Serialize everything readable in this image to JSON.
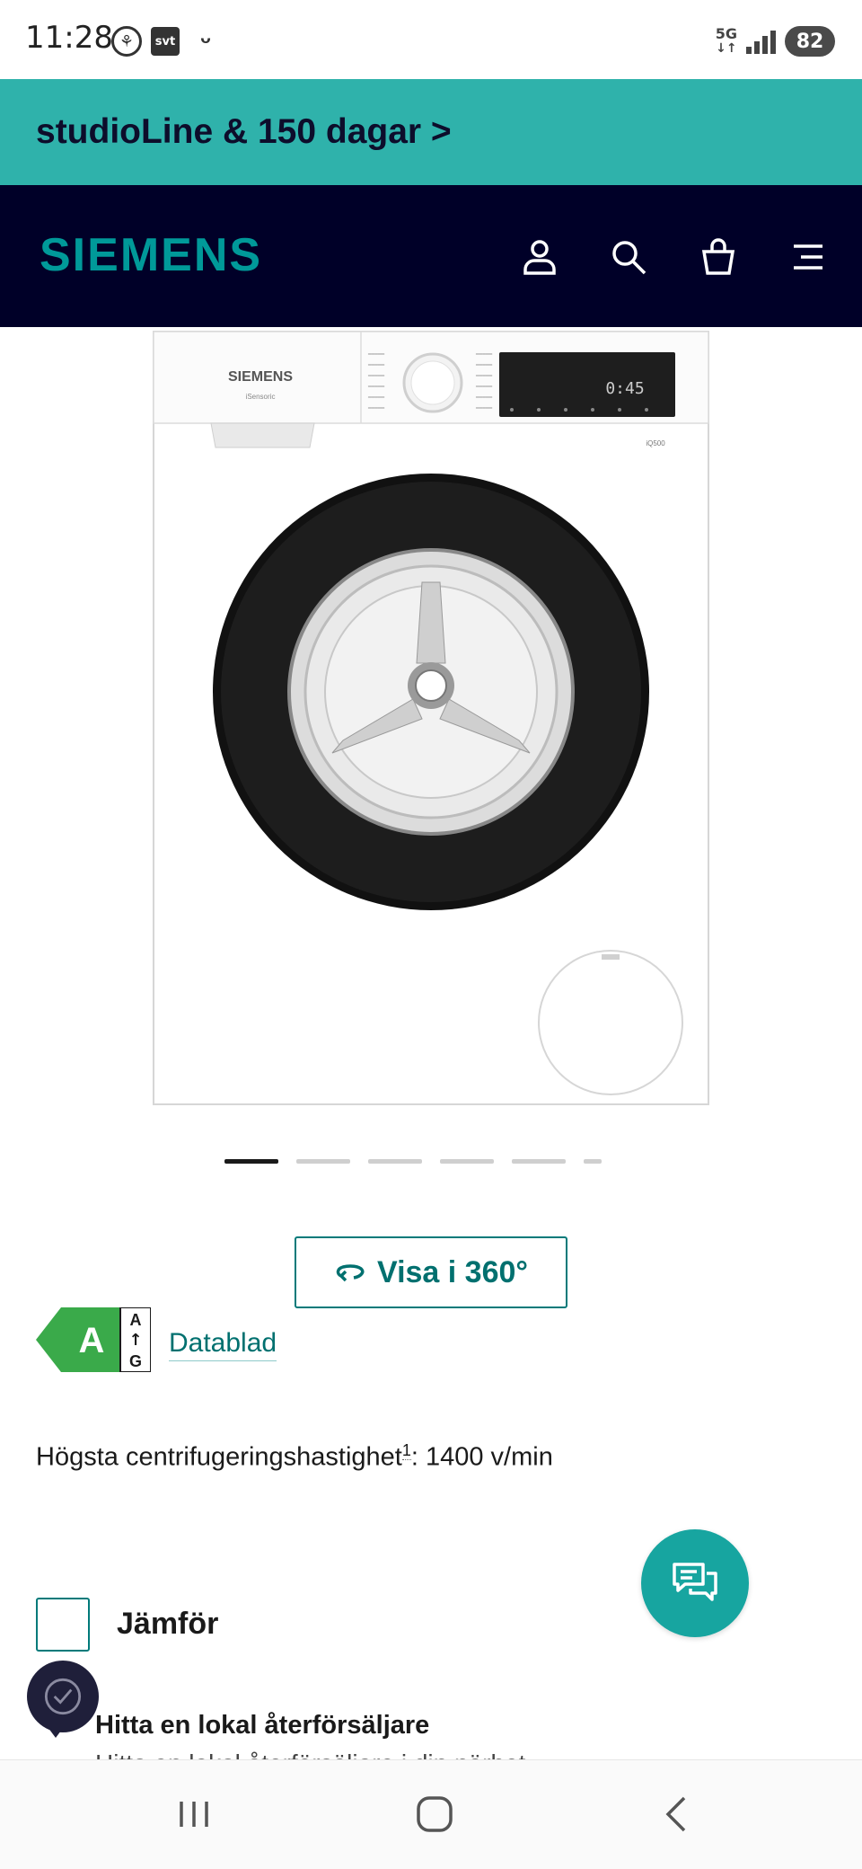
{
  "status_bar": {
    "time": "11:28",
    "svt": "svt",
    "network": "5G",
    "battery": "82"
  },
  "promo": {
    "text": "studioLine & 150 dagar >"
  },
  "header": {
    "brand": "SIEMENS",
    "icons": [
      "account-icon",
      "search-icon",
      "basket-icon",
      "menu-icon"
    ]
  },
  "product": {
    "image_brand": "SIEMENS",
    "image_sub": "iSensoric",
    "display_time": "0:45",
    "model": "iQ500",
    "carousel": {
      "count": 6,
      "active_index": 0
    }
  },
  "view360": {
    "label": "Visa i 360°"
  },
  "energy": {
    "class": "A",
    "scale_top": "A",
    "scale_bottom": "G",
    "datasheet_label": "Datablad"
  },
  "spin": {
    "label": "Högsta centrifugeringshastighet",
    "footnote": "1",
    "value": ": 1400 v/min"
  },
  "compare": {
    "label": "Jämför"
  },
  "dealer": {
    "title": "Hitta en lokal återförsäljare",
    "subtitle": "Hitta en lokal återförsäljare i din närhet"
  },
  "colors": {
    "promo": "#2fb2ab",
    "header": "#000028",
    "brand": "#009999",
    "accent": "#00706f",
    "energy_green": "#3aaa4a"
  }
}
